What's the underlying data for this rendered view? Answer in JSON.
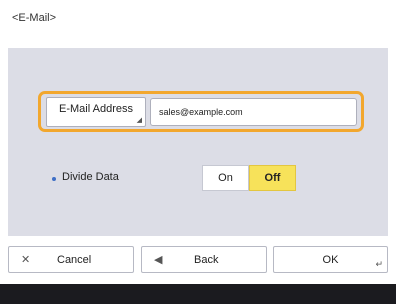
{
  "screen": {
    "title": "<E-Mail>"
  },
  "email_field": {
    "label": "E-Mail Address",
    "value": "sales@example.com"
  },
  "divide_data": {
    "label": "Divide Data",
    "on_label": "On",
    "off_label": "Off",
    "selected": "Off"
  },
  "footer": {
    "cancel_label": "Cancel",
    "back_label": "Back",
    "ok_label": "OK"
  },
  "icons": {
    "cancel": "close-icon",
    "back": "back-arrow-icon",
    "ok": "enter-corner-icon",
    "field_mark": "corner-mark-icon"
  },
  "colors": {
    "panel_bg": "#dcdde6",
    "focus_outline": "#f2a72e",
    "selected_toggle": "#f7e25a",
    "bullet": "#3f6fc6",
    "bottom_bar": "#1b1b1f"
  }
}
